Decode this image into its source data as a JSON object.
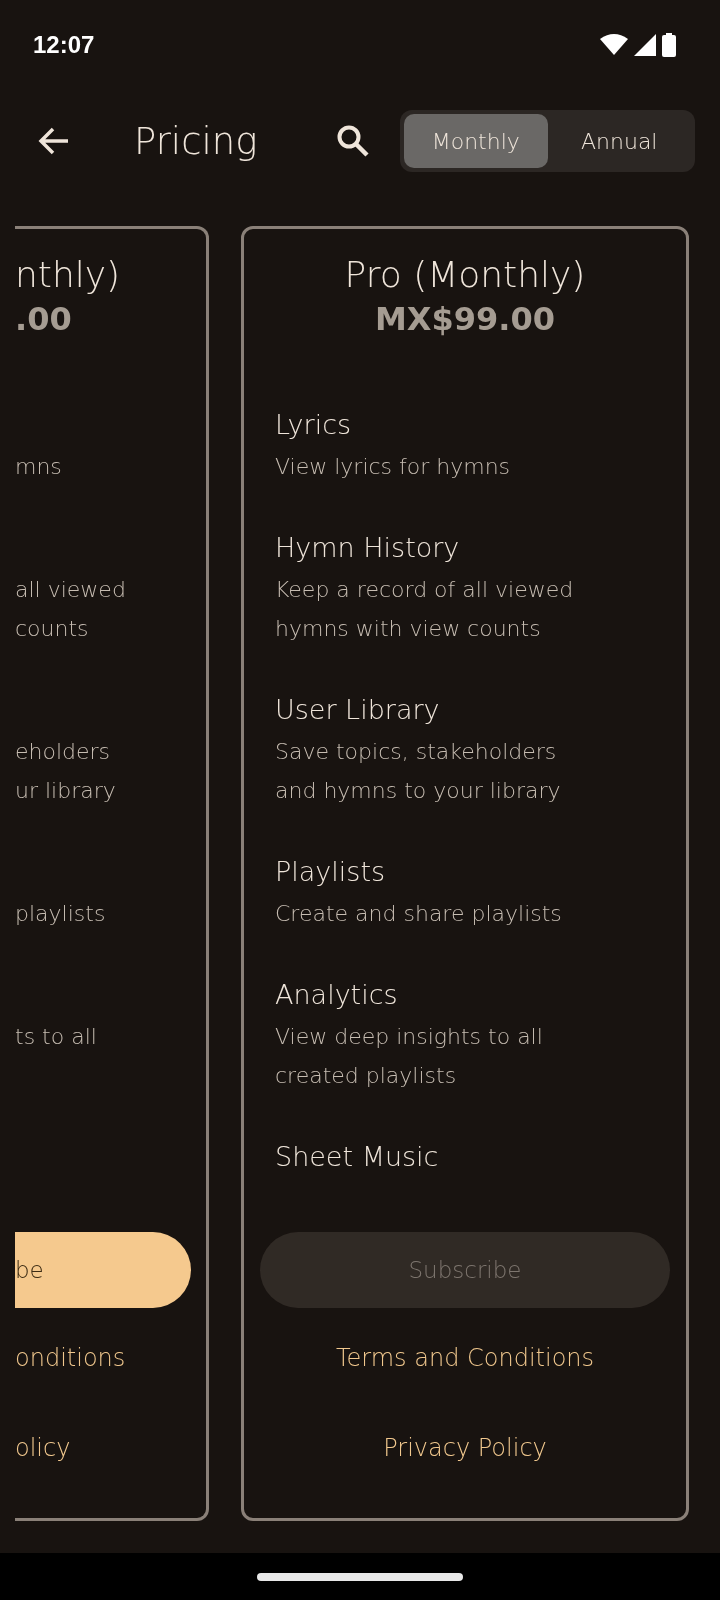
{
  "status_bar": {
    "time": "12:07"
  },
  "header": {
    "title": "Pricing"
  },
  "billing_toggle": [
    {
      "label": "Monthly",
      "selected": true
    },
    {
      "label": "Annual",
      "selected": false
    }
  ],
  "plans": [
    {
      "partial": true,
      "title": "nthly)",
      "price": ".00",
      "features": [
        {
          "description_lines": [
            "mns"
          ]
        },
        {
          "description_lines": [
            "all viewed",
            "counts"
          ]
        },
        {
          "description_lines": [
            "eholders",
            "ur library"
          ]
        },
        {
          "description_lines": [
            "playlists"
          ]
        },
        {
          "description_lines": [
            "ts to all"
          ]
        }
      ],
      "subscribe": {
        "label": "be",
        "disabled": false
      },
      "links": [
        "onditions",
        "olicy"
      ]
    },
    {
      "partial": false,
      "title": "Pro (Monthly)",
      "price": "MX$99.00",
      "features": [
        {
          "title": "Lyrics",
          "description_lines": [
            "View lyrics for hymns"
          ]
        },
        {
          "title": "Hymn History",
          "description_lines": [
            "Keep a record of all viewed",
            "hymns with view counts"
          ]
        },
        {
          "title": "User Library",
          "description_lines": [
            "Save topics, stakeholders",
            "and hymns to your library"
          ]
        },
        {
          "title": "Playlists",
          "description_lines": [
            "Create and share playlists"
          ]
        },
        {
          "title": "Analytics",
          "description_lines": [
            "View deep insights to all",
            "created playlists"
          ]
        },
        {
          "title": "Sheet Music"
        }
      ],
      "subscribe": {
        "label": "Subscribe",
        "disabled": true
      },
      "links": [
        "Terms and Conditions",
        "Privacy Policy"
      ]
    }
  ]
}
